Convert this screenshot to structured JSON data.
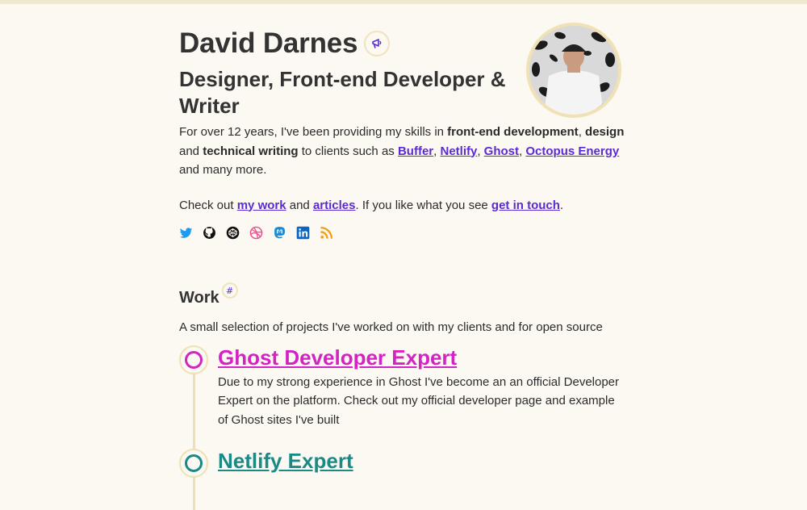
{
  "header": {
    "name": "David Darnes",
    "subtitle": "Designer, Front-end Developer & Writer"
  },
  "intro": {
    "t1": "For over 12 years, I've been providing my skills in ",
    "b1": "front-end development",
    "t2": ", ",
    "b2": "design",
    "t3": " and ",
    "b3": "technical writing",
    "t4": " to clients such as ",
    "l1": "Buffer",
    "c1": ", ",
    "l2": "Netlify",
    "c2": ", ",
    "l3": "Ghost",
    "c3": ", ",
    "l4": "Octopus Energy",
    "t5": " and many more."
  },
  "cta": {
    "t1": "Check out ",
    "l1": "my work",
    "t2": " and ",
    "l2": "articles",
    "t3": ". If you like what you see ",
    "l3": "get in touch",
    "t4": "."
  },
  "socials": [
    {
      "icon": "twitter-icon",
      "color": "#1d9bf0"
    },
    {
      "icon": "github-icon",
      "color": "#111111"
    },
    {
      "icon": "codepen-icon",
      "color": "#111111"
    },
    {
      "icon": "dribbble-icon",
      "color": "#ea4c89"
    },
    {
      "icon": "mastodon-icon",
      "color": "#1a8ad6"
    },
    {
      "icon": "linkedin-icon",
      "color": "#0a66c2"
    },
    {
      "icon": "rss-icon",
      "color": "#f39c12"
    }
  ],
  "work": {
    "heading": "Work",
    "hash": "#",
    "subtitle": "A small selection of projects I've worked on with my clients and for open source",
    "items": [
      {
        "title": "Ghost Developer Expert",
        "description": "Due to my strong experience in Ghost I've become an an official Developer Expert on the platform. Check out my official developer page and example of Ghost sites I've built"
      },
      {
        "title": "Netlify Expert",
        "description": ""
      }
    ]
  },
  "colors": {
    "background": "#fcf9f2",
    "link": "#5a2bd1",
    "accent_pink": "#d323c3",
    "accent_teal": "#1a8a86",
    "ring": "#efe0b3"
  }
}
